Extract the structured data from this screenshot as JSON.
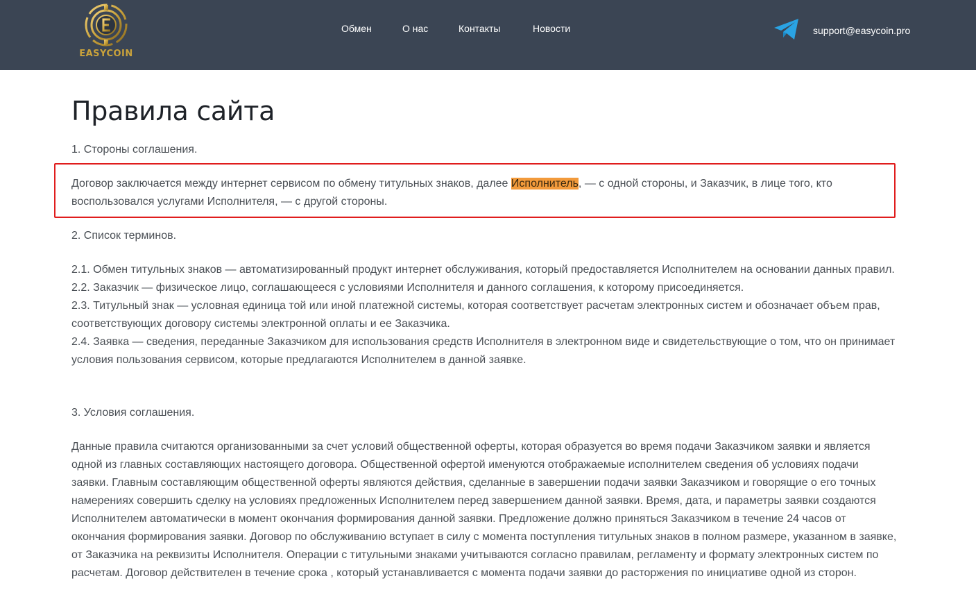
{
  "header": {
    "logo_text": "EASYCOIN",
    "nav": [
      {
        "label": "Обмен"
      },
      {
        "label": "О нас"
      },
      {
        "label": "Контакты"
      },
      {
        "label": "Новости"
      }
    ],
    "email": "support@easycoin.pro",
    "background_color": "#3b4554",
    "accent_color": "#c9a23b"
  },
  "page": {
    "title": "Правила сайта",
    "section1_heading": "1. Стороны соглашения.",
    "section1_text_before": "Договор заключается между интернет сервисом по обмену титульных знаков, далее ",
    "section1_highlight": "Исполнитель",
    "section1_text_after": ", — с одной стороны, и Заказчик, в лице того, кто воспользовался услугами Исполнителя, — с другой стороны.",
    "section2_heading": "2. Список терминов.",
    "section2_items": [
      "2.1. Обмен титульных знаков — автоматизированный продукт интернет обслуживания, который предоставляется Исполнителем на основании данных правил.",
      "2.2. Заказчик — физическое лицо, соглашающееся с условиями Исполнителя и данного соглашения, к которому присоединяется.",
      "2.3. Титульный знак — условная единица той или иной платежной системы, которая соответствует расчетам электронных систем и обозначает объем прав, соответствующих договору системы электронной оплаты и ее Заказчика.",
      "2.4. Заявка — сведения, переданные Заказчиком для использования средств Исполнителя в электронном виде и свидетельствующие о том, что он принимает условия пользования сервисом, которые предлагаются Исполнителем в данной заявке."
    ],
    "section3_heading": "3. Условия соглашения.",
    "section3_text": "Данные правила считаются организованными за счет условий общественной оферты, которая образуется во время подачи Заказчиком заявки и является одной из главных составляющих настоящего договора. Общественной офертой именуются отображаемые исполнителем сведения об условиях подачи заявки. Главным составляющим общественной оферты являются действия, сделанные в завершении подачи заявки Заказчиком и говорящие о его точных намерениях совершить сделку на условиях предложенных Исполнителем перед завершением данной заявки. Время, дата, и параметры заявки создаются Исполнителем автоматически в момент окончания формирования данной заявки. Предложение должно приняться Заказчиком в течение 24 часов от окончания формирования заявки. Договор по обслуживанию вступает в силу с момента поступления титульных знаков в полном размере, указанном в заявке, от Заказчика на реквизиты Исполнителя. Операции с титульными знаками учитываются согласно правилам, регламенту и формату электронных систем по расчетам. Договор действителен в течение срока , который устанавливается с момента подачи заявки до расторжения по инициативе одной из сторон.",
    "highlight_color": "#f29a3b",
    "box_color": "#e01d1d"
  }
}
